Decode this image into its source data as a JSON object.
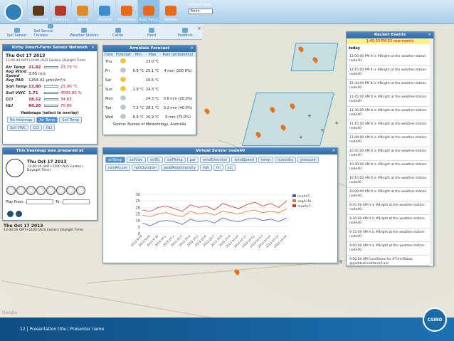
{
  "toolbar": {
    "buttons": [
      {
        "label": "Dashboard"
      },
      {
        "label": "Overlays"
      },
      {
        "label": "Alerts"
      },
      {
        "label": "Outlook"
      },
      {
        "label": "Fullscreen"
      },
      {
        "label": "Auto Focus"
      },
      {
        "label": "Refresh"
      }
    ],
    "refresh_rate_label": "Refresh Rate",
    "refresh_rate_value": "5min"
  },
  "layerbar": {
    "items": [
      {
        "label": "Soil Sensor"
      },
      {
        "label": "Soil Sensor Clusters"
      },
      {
        "label": "Weather Station"
      },
      {
        "label": "Cattle"
      },
      {
        "label": "Herd"
      },
      {
        "label": "Paddock"
      }
    ],
    "close": "×"
  },
  "kirby": {
    "title": "Kirby Smart-Farm Sensor Network",
    "close": "×",
    "date": "Thu Oct 17 2013",
    "time": "13:45:44 GMT+1100 (AUS Eastern Daylight Time)",
    "rows": [
      {
        "label": "Air Temp",
        "value": "21.82",
        "unit_value": "23.73 °C"
      },
      {
        "label": "Avg Wind Speed",
        "value": "3.65 m/s",
        "unit_value": ""
      },
      {
        "label": "Avg PAR",
        "value": "1264.42 µmol/m²/s",
        "unit_value": ""
      },
      {
        "label": "Soil Temp",
        "value": "13.80",
        "unit_value": "23.90 °C"
      },
      {
        "label": "Soil VWC",
        "value": "1.71",
        "unit_value": "4093.00 %"
      },
      {
        "label": "CCI",
        "value": "18.12",
        "unit_value": "34.63"
      },
      {
        "label": "HLI",
        "value": "84.26",
        "unit_value": "70.80"
      }
    ],
    "heatmaps_title": "Heatmaps (select to overlay)",
    "heatmaps": [
      {
        "label": "No Heatmap"
      },
      {
        "label": "Air Temp"
      },
      {
        "label": "Soil Temp"
      },
      {
        "label": "Soil VWC"
      },
      {
        "label": "CCI"
      },
      {
        "label": "HLI"
      }
    ]
  },
  "armidale": {
    "title": "Armidale Forecast",
    "close": "×",
    "headers": [
      "Date",
      "Forecast",
      "Min",
      "Max",
      "Rain (probability)"
    ],
    "rows": [
      {
        "day": "Thu",
        "min": "",
        "max": "23.0 °C",
        "rain": ""
      },
      {
        "day": "Fri",
        "min": "6.9 °C",
        "max": "25.1 °C",
        "rain": "4 mm (100.0%)"
      },
      {
        "day": "Sat",
        "min": "",
        "max": "16.6 °C",
        "rain": ""
      },
      {
        "day": "Sun",
        "min": "2.9 °C",
        "max": "24.3 °C",
        "rain": ""
      },
      {
        "day": "Mon",
        "min": "",
        "max": "24.3 °C",
        "rain": "0.6 mm (20.0%)"
      },
      {
        "day": "Tue",
        "min": "7.3 °C",
        "max": "28.1 °C",
        "rain": "0.2 mm (40.0%)"
      },
      {
        "day": "Wed",
        "min": "6.9 °C",
        "max": "26.9 °C",
        "rain": "9 mm (75.0%)"
      }
    ],
    "source": "Source: Bureau of Meteorology, Australia"
  },
  "heatinfo": {
    "title": "This heatmap was prepared at",
    "date": "Thu Oct 17 2013",
    "time": "13:40:16 GMT+1100 (AUS Eastern Daylight Time)",
    "date2": "Thu Oct 17 2013",
    "time2": "13:40:16 GMT+1100 (AUS Eastern Daylight Time)",
    "play_from": "Play From:",
    "to": "To:"
  },
  "sensor": {
    "title": "Virtual Sensor node40",
    "close": "×",
    "tabs": [
      "airTemp",
      "soilVwc",
      "soilEc",
      "soilTemp",
      "par",
      "windDirection",
      "windSpeed",
      "temp",
      "humidity",
      "pressure",
      "rainAccum",
      "rainDuration",
      "peakRainIntensity",
      "hail",
      "hli",
      "cci"
    ]
  },
  "chart_data": {
    "type": "line",
    "x": [
      "2013-9-28",
      "2013-9-29",
      "2013-9-30",
      "2013-10-1",
      "2013-10-2",
      "2013-10-3",
      "2013-10-4",
      "2013-10-5",
      "2013-10-6",
      "2013-10-7",
      "2013-10-8",
      "2013-10-9",
      "2013-10-10",
      "2013-10-11",
      "2013-10-12",
      "2013-10-13",
      "2013-10-14",
      "2013-10-15",
      "2013-10-16"
    ],
    "series": [
      {
        "name": "minAirT...",
        "color": "#3a5fcd",
        "values": [
          8,
          6,
          9,
          10,
          9,
          7,
          11,
          9,
          10,
          8,
          12,
          10,
          9,
          11,
          12,
          10,
          11,
          9,
          12
        ]
      },
      {
        "name": "avgAirTe...",
        "color": "#e8731c",
        "values": [
          14,
          13,
          15,
          16,
          14,
          13,
          17,
          15,
          16,
          14,
          17,
          16,
          15,
          17,
          18,
          16,
          17,
          16,
          19
        ]
      },
      {
        "name": "maxAirT...",
        "color": "#d9302c",
        "values": [
          18,
          17,
          20,
          21,
          19,
          17,
          22,
          20,
          21,
          18,
          23,
          21,
          19,
          22,
          24,
          21,
          23,
          20,
          25
        ]
      }
    ],
    "ylim": [
      0,
      30
    ],
    "yticks": [
      0,
      5,
      10,
      15,
      20,
      25,
      30
    ],
    "grid": true,
    "legend": "right"
  },
  "events": {
    "title": "Recent Events",
    "close": "×",
    "banner": "1:45:33 PM 53 new events",
    "day": "today",
    "items": [
      "12:00:00 PM It is #Bright at the weather-station node40",
      "12:15:00 PM It is #Bright at the weather-station node40",
      "12:30:00 PM It is #Bright at the weather-station node40",
      "11:45:00 AM It is #Bright at the weather-station node40",
      "11:30:00 AM It is #Bright at the weather-station node40",
      "11:15:00 AM It is #Bright at the weather-station node40",
      "11:00:00 AM It is #Bright at the weather-station node40",
      "10:45:00 AM It is #Bright at the weather-station node40",
      "10:30:00 AM It is #Bright at the weather-station node40",
      "10:15:00 AM It is #Bright at the weather-station node40",
      "10:00:00 AM It is #Bright at the weather-station node40",
      "9:45:00 AM It is #Bright at the weather-station node40",
      "9:30:00 AM It is #Bright at the weather-station node40",
      "9:15:00 AM It is #Bright at the weather-station node40",
      "9:00:00 AM It is #Bright at the weather-station node40",
      "9:00:00 AM Conditions for #TimeToSow @paddockvisitfarm6 are"
    ]
  },
  "map": {
    "scale_label": "5",
    "google": "Google"
  },
  "footer": {
    "text": "12  |  Presentation title  |  Presenter name",
    "logo": "CSIRO"
  }
}
